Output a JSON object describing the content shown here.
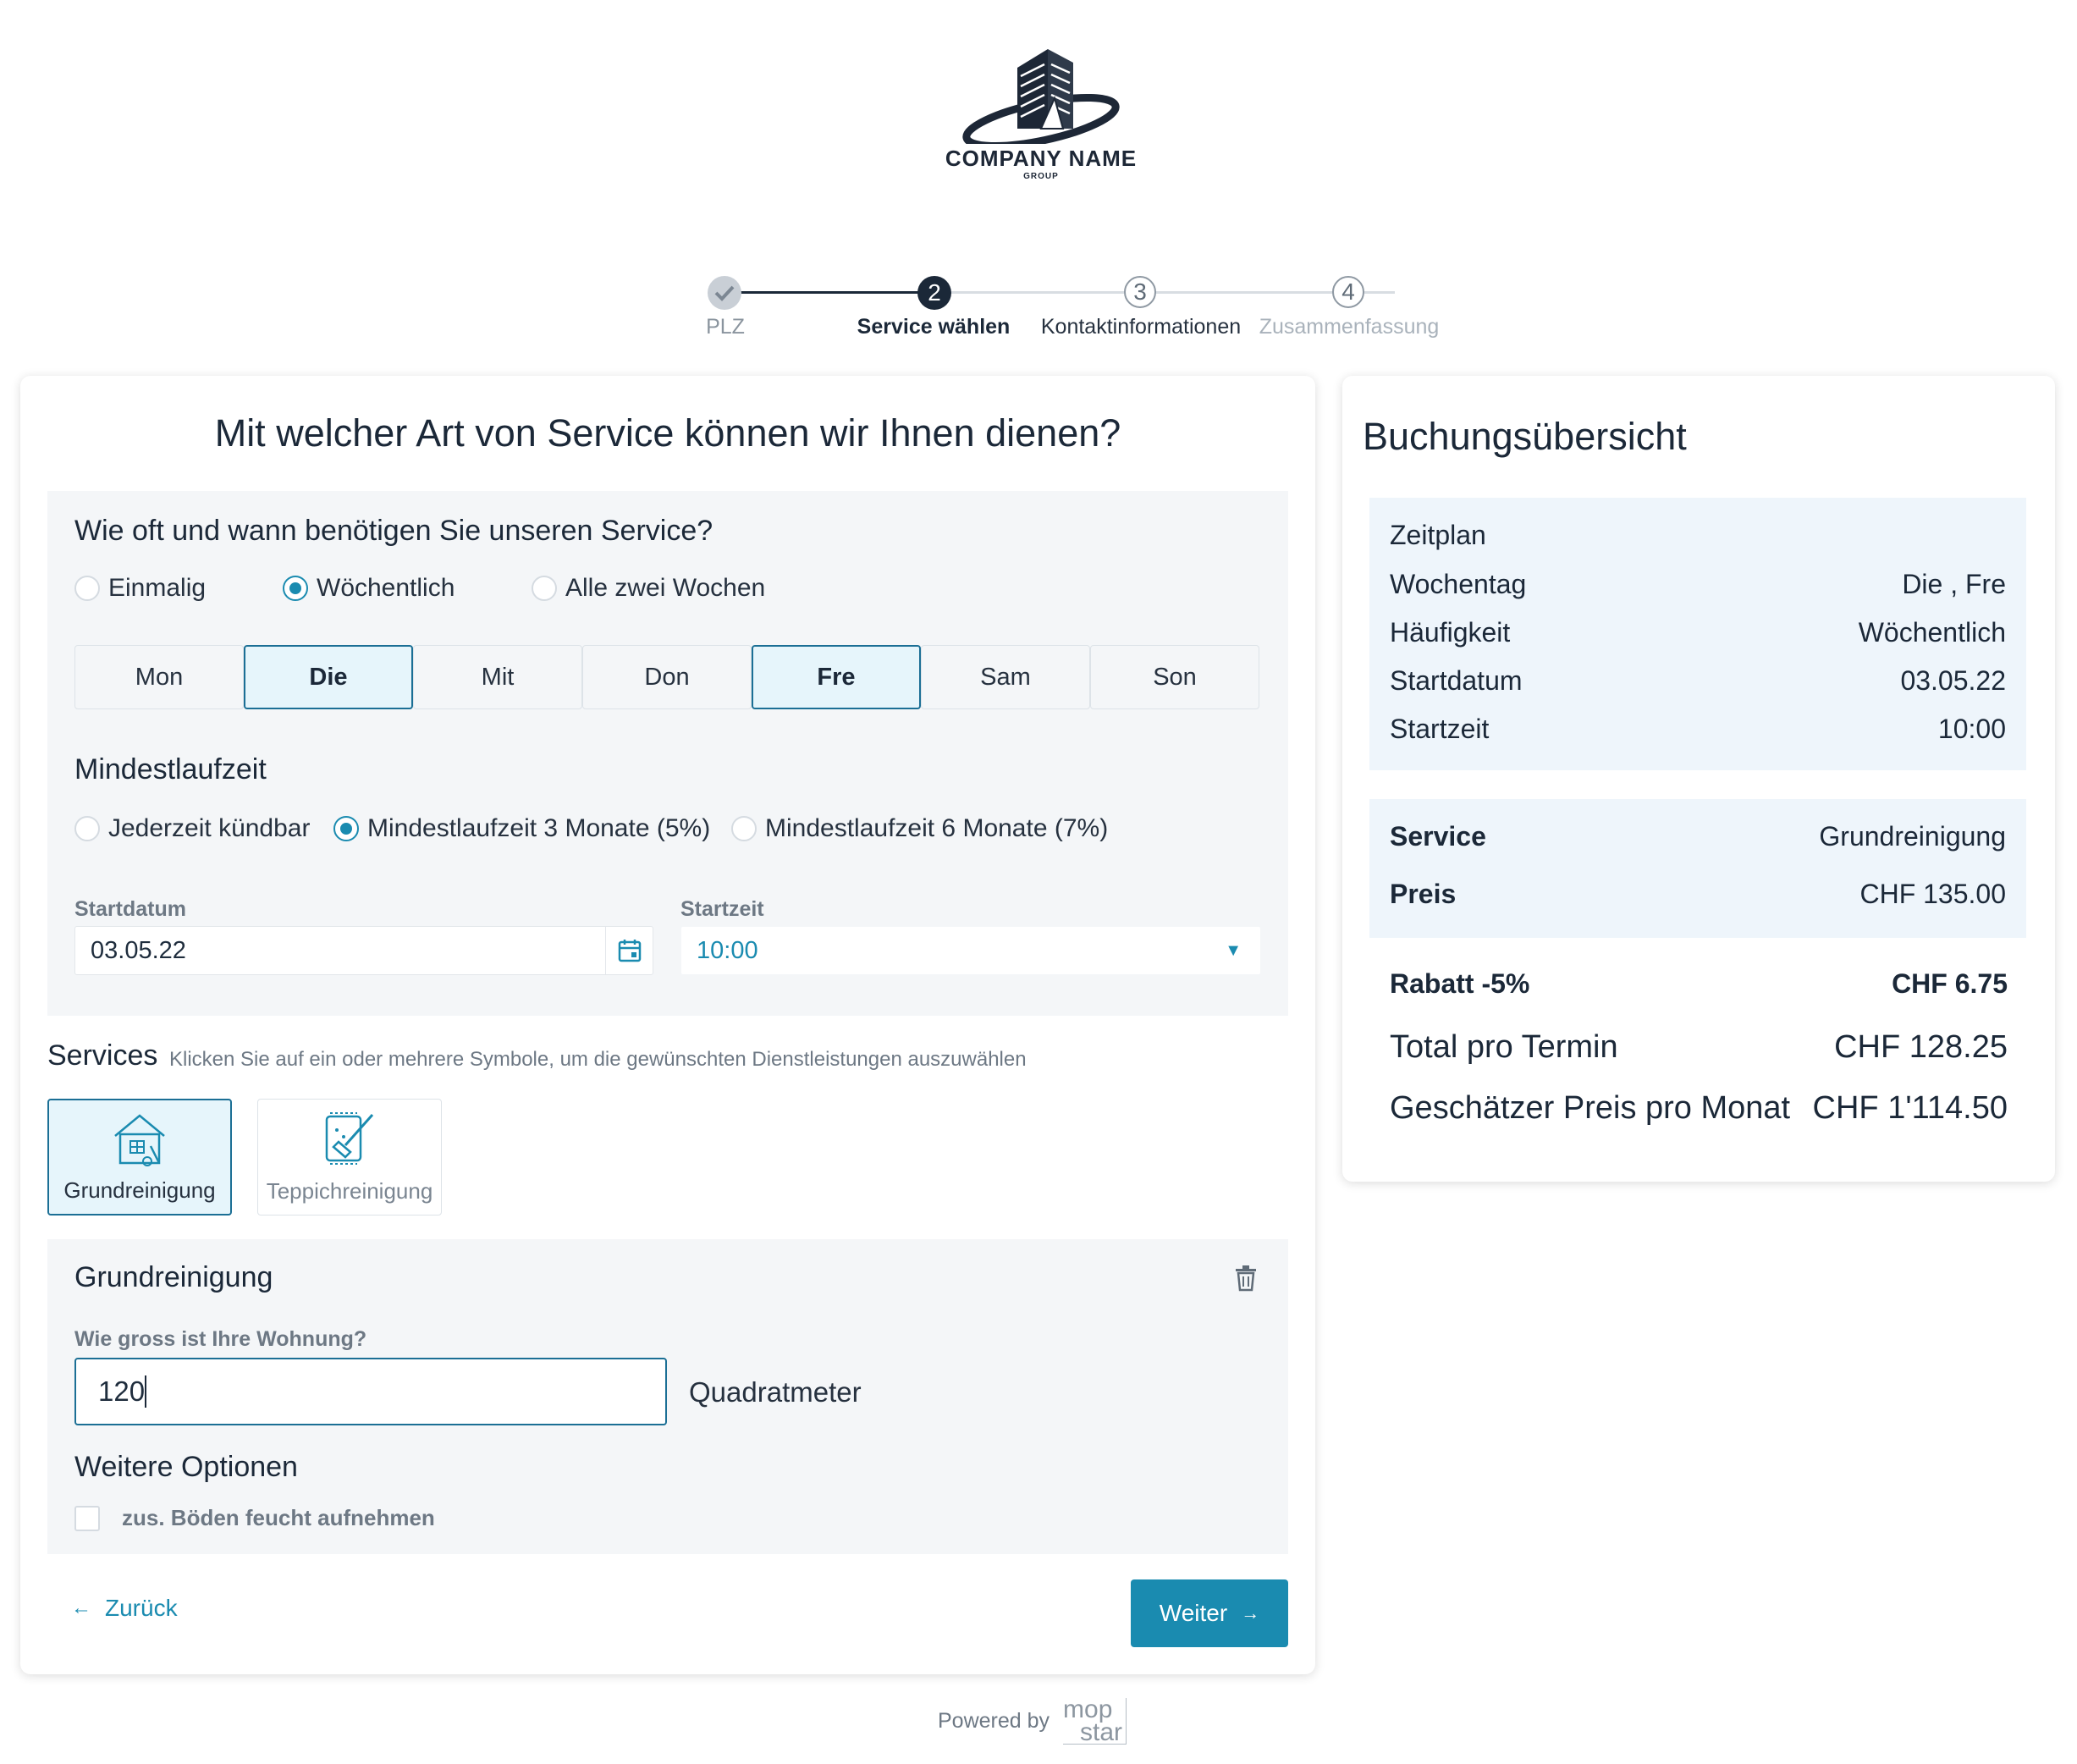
{
  "logo": {
    "name": "COMPANY NAME",
    "sub": "GROUP"
  },
  "stepper": {
    "steps": [
      {
        "number": "",
        "label": "PLZ",
        "state": "done"
      },
      {
        "number": "2",
        "label": "Service wählen",
        "state": "active"
      },
      {
        "number": "3",
        "label": "Kontaktinformationen",
        "state": "todo"
      },
      {
        "number": "4",
        "label": "Zusammenfassung",
        "state": "todo"
      }
    ]
  },
  "main": {
    "title": "Mit welcher Art von Service können wir Ihnen dienen?",
    "frequency": {
      "heading": "Wie oft und wann benötigen Sie unseren Service?",
      "options": [
        "Einmalig",
        "Wöchentlich",
        "Alle zwei Wochen"
      ],
      "selected": "Wöchentlich"
    },
    "days": [
      {
        "label": "Mon",
        "selected": false
      },
      {
        "label": "Die",
        "selected": true
      },
      {
        "label": "Mit",
        "selected": false
      },
      {
        "label": "Don",
        "selected": false
      },
      {
        "label": "Fre",
        "selected": true
      },
      {
        "label": "Sam",
        "selected": false
      },
      {
        "label": "Son",
        "selected": false
      }
    ],
    "duration": {
      "heading": "Mindestlaufzeit",
      "options": [
        "Jederzeit kündbar",
        "Mindestlaufzeit 3 Monate (5%)",
        "Mindestlaufzeit 6 Monate (7%)"
      ],
      "selected": "Mindestlaufzeit 3 Monate (5%)"
    },
    "start_date": {
      "label": "Startdatum",
      "value": "03.05.22"
    },
    "start_time": {
      "label": "Startzeit",
      "value": "10:00"
    },
    "services": {
      "heading": "Services",
      "hint": "Klicken Sie auf ein oder mehrere Symbole, um die gewünschten Dienstleistungen auszuwählen",
      "items": [
        {
          "label": "Grundreinigung",
          "selected": true
        },
        {
          "label": "Teppichreinigung",
          "selected": false
        }
      ]
    },
    "detail": {
      "heading": "Grundreinigung",
      "size_label": "Wie gross ist Ihre Wohnung?",
      "size_value": "120",
      "unit": "Quadratmeter",
      "options_heading": "Weitere Optionen",
      "option_label": "zus. Böden feucht aufnehmen"
    },
    "back_label": "Zurück",
    "next_label": "Weiter"
  },
  "summary": {
    "title": "Buchungsübersicht",
    "schedule_heading": "Zeitplan",
    "schedule": [
      {
        "key": "Wochentag",
        "value": "Die , Fre"
      },
      {
        "key": "Häufigkeit",
        "value": "Wöchentlich"
      },
      {
        "key": "Startdatum",
        "value": "03.05.22"
      },
      {
        "key": "Startzeit",
        "value": "10:00"
      }
    ],
    "service": {
      "key": "Service",
      "value": "Grundreinigung"
    },
    "price": {
      "key": "Preis",
      "value": "CHF 135.00"
    },
    "discount": {
      "key": "Rabatt -5%",
      "value": "CHF 6.75"
    },
    "total": {
      "key": "Total pro Termin",
      "value": "CHF 128.25"
    },
    "monthly": {
      "key": "Geschätzer Preis pro Monat",
      "value": "CHF 1'114.50"
    }
  },
  "footer": {
    "powered_by": "Powered by",
    "brand_top": "mop",
    "brand_bottom": "star"
  },
  "colors": {
    "accent": "#1a8bb0",
    "dark": "#1b2838",
    "panel": "#f4f6f8",
    "summary_panel": "#eef5fb"
  }
}
